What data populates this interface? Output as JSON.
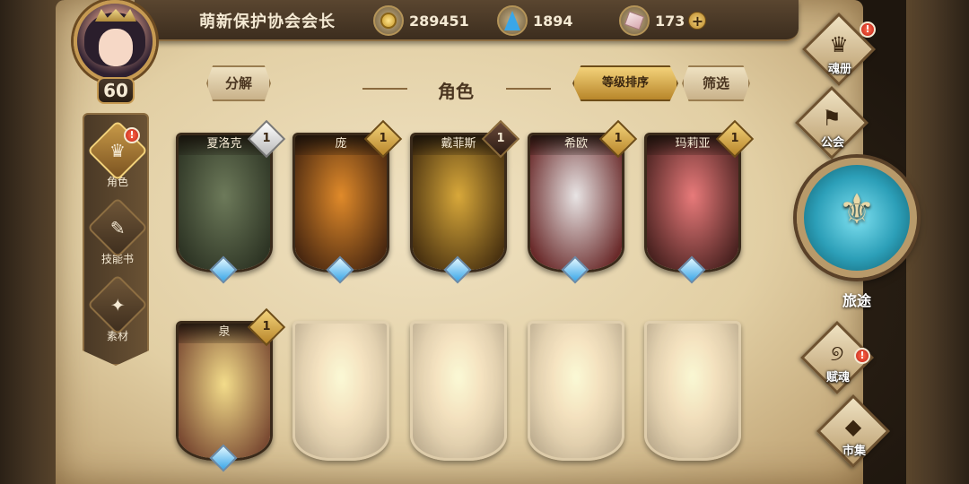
{
  "player": {
    "name": "萌新保护协会会长",
    "level": "60"
  },
  "resources": {
    "gold": "289451",
    "crystal": "1894",
    "gem": "173",
    "plus": "+"
  },
  "left_nav": {
    "items": [
      {
        "label": "角色",
        "glyph": "♛",
        "alert": "!"
      },
      {
        "label": "技能书",
        "glyph": "✎"
      },
      {
        "label": "素材",
        "glyph": "✦"
      }
    ]
  },
  "header": {
    "decompose": "分解",
    "title": "角色",
    "sort": "等级排序",
    "filter": "筛选"
  },
  "heroes": [
    {
      "name": "夏洛克",
      "level": "1",
      "badge": "silver",
      "colors": [
        "#6d7a5a",
        "#2d3424"
      ]
    },
    {
      "name": "庞",
      "level": "1",
      "badge": "gold",
      "colors": [
        "#e08a2a",
        "#4a2810"
      ]
    },
    {
      "name": "戴菲斯",
      "level": "1",
      "badge": "dark",
      "colors": [
        "#d8a83a",
        "#4a3210"
      ]
    },
    {
      "name": "希欧",
      "level": "1",
      "badge": "gold",
      "colors": [
        "#e8e4e4",
        "#6a2a2a"
      ]
    },
    {
      "name": "玛莉亚",
      "level": "1",
      "badge": "gold",
      "colors": [
        "#e87a7a",
        "#4a2220"
      ]
    },
    {
      "name": "泉",
      "level": "1",
      "badge": "gold",
      "colors": [
        "#f3dc8a",
        "#7a4a32"
      ]
    }
  ],
  "locked_heroes": 4,
  "right_menu": {
    "album": {
      "label": "魂册",
      "glyph": "♛",
      "alert": "!"
    },
    "guild": {
      "label": "公会",
      "glyph": "⚑"
    },
    "journey": {
      "label": "旅途",
      "glyph": "⚜"
    },
    "soul": {
      "label": "赋魂",
      "glyph": "୭",
      "alert": "!"
    },
    "market": {
      "label": "市集",
      "glyph": "◆"
    }
  }
}
